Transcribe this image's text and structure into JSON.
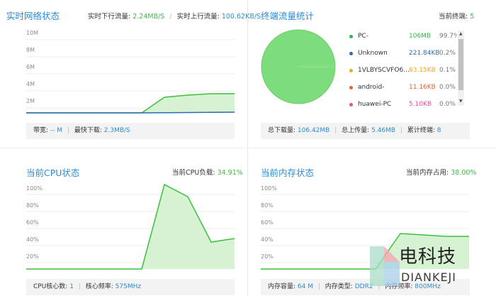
{
  "net": {
    "title": "实时网络状态",
    "down_label": "实时下行流量:",
    "down_value": "2.24MB/S",
    "up_label": "实时上行流量:",
    "up_value": "100.62KB/S",
    "yticks": [
      "10M",
      "8M",
      "6M",
      "4M",
      "2M"
    ],
    "footer": {
      "bandwidth_label": "带宽:",
      "bandwidth_value": "-- M",
      "maxdown_label": "最快下载:",
      "maxdown_value": "2.3MB/S"
    }
  },
  "term": {
    "title": "终端流量统计",
    "count_label": "当前终端:",
    "count_value": "5",
    "legend": [
      {
        "name": "PC-",
        "size": "106MB",
        "pct": "99.7%",
        "color": "#2db84a"
      },
      {
        "name": "Unknown",
        "size": "221.84KB",
        "pct": "0.2%",
        "color": "#2a6cb8"
      },
      {
        "name": "1VLBYSCVFO6...",
        "size": "63.15KB",
        "pct": "0.1%",
        "color": "#f2a71e"
      },
      {
        "name": "android-",
        "size": "11.16KB",
        "pct": "0.0%",
        "color": "#e8632b"
      },
      {
        "name": "huawei-PC",
        "size": "5.10KB",
        "pct": "0.0%",
        "color": "#e0509a"
      }
    ],
    "footer": {
      "total_down_label": "总下载量:",
      "total_down_value": "106.42MB",
      "total_up_label": "总上传量:",
      "total_up_value": "5.46MB",
      "accum_label": "累计终端:",
      "accum_value": "8"
    }
  },
  "cpu": {
    "title": "当前CPU状态",
    "load_label": "当前CPU负载:",
    "load_value": "34.91%",
    "yticks": [
      "100%",
      "80%",
      "60%",
      "40%",
      "20%"
    ],
    "footer": {
      "cores_label": "CPU核心数:",
      "cores_value": "1",
      "freq_label": "核心频率:",
      "freq_value": "575MHz"
    }
  },
  "mem": {
    "title": "当前内存状态",
    "usage_label": "当前内存占用:",
    "usage_value": "38.00%",
    "yticks": [
      "100%",
      "80%",
      "60%",
      "40%",
      "20%"
    ],
    "footer": {
      "cap_label": "内存容量:",
      "cap_value": "64 M",
      "type_label": "内存类型:",
      "type_value": "DDR2",
      "freq_label": "内存频率:",
      "freq_value": "800MHz"
    }
  },
  "watermark": {
    "cn": "电科技",
    "en": "DIANKEJI"
  },
  "colors": {
    "accent": "#2a8cd4",
    "green_line": "#3cc03c",
    "green_fill": "#d7f2d2",
    "pie": "#7ddc7b"
  }
}
